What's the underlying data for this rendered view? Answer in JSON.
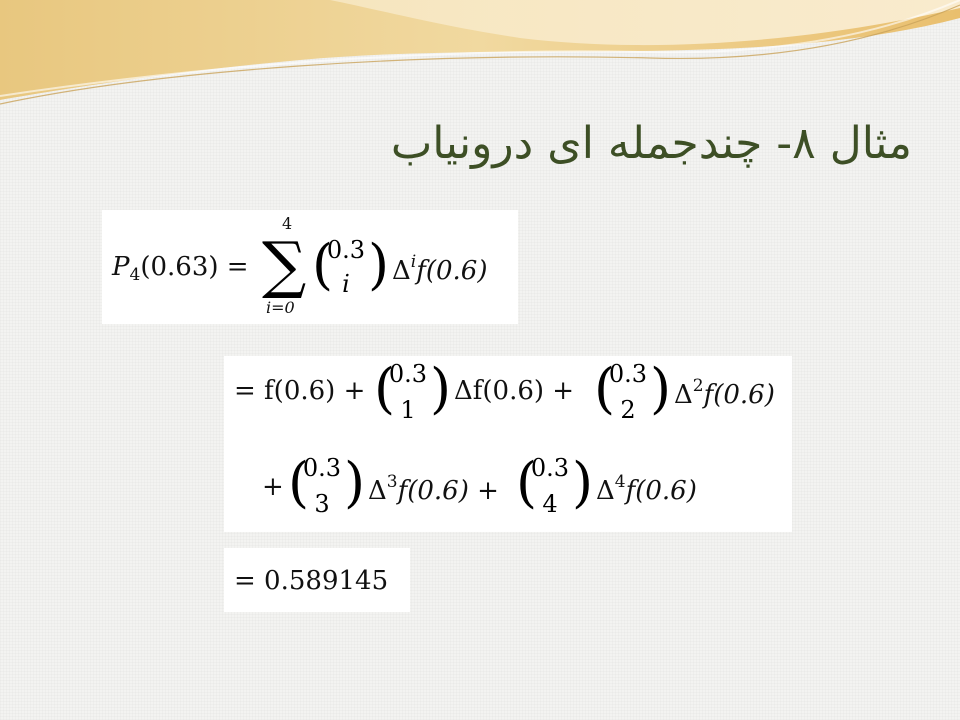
{
  "slide": {
    "title": "مثال ۸- چندجمله ای درونیاب"
  },
  "equation1": {
    "lhs": "P",
    "lhs_sub": "4",
    "lhs_arg": "(0.63) =",
    "sum_upper": "4",
    "sum_lower": "i=0",
    "binom_top": "0.3",
    "binom_bottom": "i",
    "delta": "Δ",
    "delta_exp": "i",
    "tail": "f(0.6)"
  },
  "equation2": {
    "line1": {
      "start": "= f(0.6) +",
      "b1_top": "0.3",
      "b1_bottom": "1",
      "term1": "Δf(0.6) +",
      "b2_top": "0.3",
      "b2_bottom": "2",
      "term2_delta": "Δ",
      "term2_exp": "2",
      "term2_tail": "f(0.6)"
    },
    "line2": {
      "start": "+",
      "b3_top": "0.3",
      "b3_bottom": "3",
      "term3_delta": "Δ",
      "term3_exp": "3",
      "term3_tail": "f(0.6) +",
      "b4_top": "0.3",
      "b4_bottom": "4",
      "term4_delta": "Δ",
      "term4_exp": "4",
      "term4_tail": "f(0.6)"
    }
  },
  "equation3": {
    "result": "= 0.589145"
  }
}
